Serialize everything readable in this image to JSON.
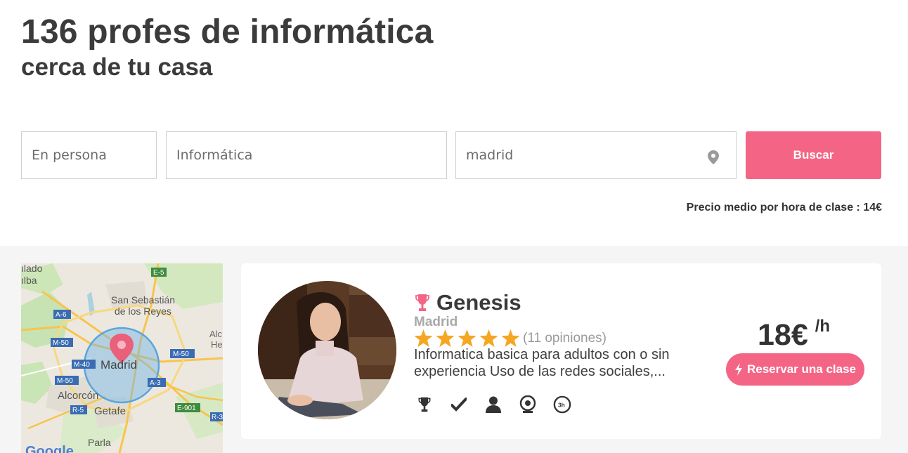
{
  "header": {
    "title": "136 profes de informática",
    "subtitle": "cerca de tu casa"
  },
  "search": {
    "mode_value": "En persona",
    "subject_value": "Informática",
    "city_value": "madrid",
    "submit_label": "Buscar"
  },
  "average_price": "Precio medio por hora de clase : 14€",
  "map": {
    "labels": {
      "top_left_1": "ılado",
      "top_left_2": "ılba",
      "san_sebastian_1": "San Sebastián",
      "san_sebastian_2": "de los Reyes",
      "madrid": "Madrid",
      "alcorcon": "Alcorcón",
      "getafe": "Getafe",
      "parla": "Parla",
      "alc": "Alc",
      "he": "He",
      "google": "Google"
    },
    "roads": {
      "e5": "E-5",
      "a6": "A-6",
      "m50_a": "M-50",
      "m50_b": "M-50",
      "m50_c": "M-50",
      "m40": "M-40",
      "a3": "A-3",
      "r5": "R-5",
      "e901": "E-901",
      "r3": "R-3"
    }
  },
  "teacher": {
    "name": "Genesis",
    "city": "Madrid",
    "rating": 5,
    "reviews": "(11 opiniones)",
    "description": "Informatica basica para adultos con o sin experiencia Uso de las redes sociales,...",
    "price": "18€",
    "price_unit": "/h",
    "book_label": "Reservar una clase",
    "badges": [
      "trophy-icon",
      "check-icon",
      "user-icon",
      "webcam-icon",
      "3h-icon"
    ],
    "badge_3h": "3h"
  },
  "colors": {
    "accent": "#f46585",
    "star": "#f5a623",
    "band": "#f5f5f5"
  }
}
